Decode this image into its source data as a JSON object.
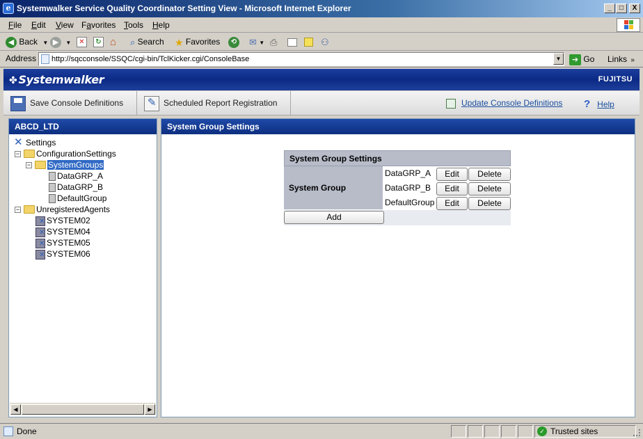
{
  "window": {
    "title": "Systemwalker Service Quality Coordinator Setting View - Microsoft Internet Explorer",
    "minimize": "_",
    "maximize": "□",
    "close": "X"
  },
  "menu": [
    "File",
    "Edit",
    "View",
    "Favorites",
    "Tools",
    "Help"
  ],
  "menu_underline": [
    "F",
    "E",
    "V",
    "a",
    "T",
    "H"
  ],
  "toolbar": {
    "back": "Back",
    "search": "Search",
    "favorites": "Favorites"
  },
  "address": {
    "label": "Address",
    "url": "http://sqcconsole/SSQC/cgi-bin/TclKicker.cgi/ConsoleBase",
    "go": "Go",
    "links": "Links"
  },
  "banner": {
    "brand": "Systemwalker",
    "vendor": "FUJITSU"
  },
  "funcbar": {
    "save": "Save Console Definitions",
    "schedule": "Scheduled Report Registration",
    "update": "Update Console Definitions",
    "help": "Help"
  },
  "leftpanel": {
    "title": "ABCD_LTD",
    "tree": {
      "root": "Settings",
      "config": "ConfigurationSettings",
      "systemgroups": "SystemGroups",
      "groups": [
        "DataGRP_A",
        "DataGRP_B",
        "DefaultGroup"
      ],
      "unregistered": "UnregisteredAgents",
      "agents": [
        "SYSTEM02",
        "SYSTEM04",
        "SYSTEM05",
        "SYSTEM06"
      ]
    }
  },
  "rightpanel": {
    "title": "System Group Settings",
    "table_title": "System Group Settings",
    "row_label": "System Group",
    "groups": [
      "DataGRP_A",
      "DataGRP_B",
      "DefaultGroup"
    ],
    "edit": "Edit",
    "delete": "Delete",
    "add": "Add"
  },
  "status": {
    "text": "Done",
    "zone": "Trusted sites"
  }
}
